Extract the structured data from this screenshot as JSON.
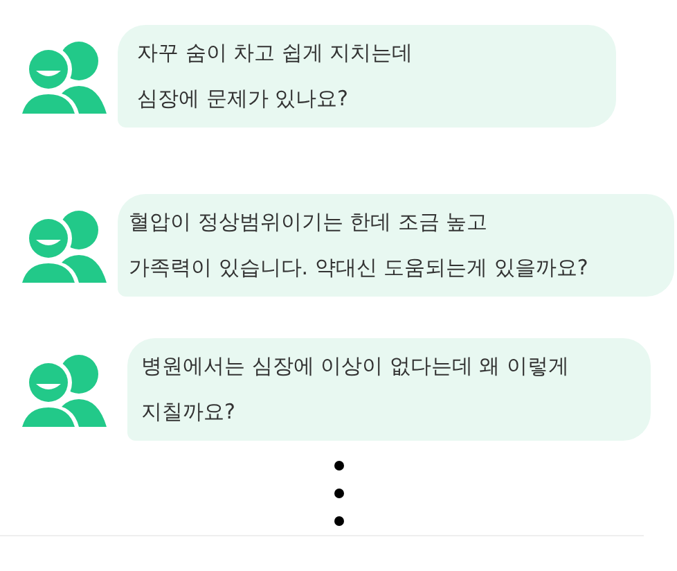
{
  "messages": [
    {
      "lines": [
        "자꾸 숨이 차고 쉽게 지치는데",
        "심장에 문제가 있나요?"
      ]
    },
    {
      "lines": [
        "혈압이 정상범위이기는 한데 조금 높고",
        "가족력이 있습니다. 약대신 도움되는게 있을까요?"
      ]
    },
    {
      "lines": [
        "병원에서는 심장에 이상이 없다는데 왜 이렇게",
        "지칠까요?"
      ]
    }
  ]
}
